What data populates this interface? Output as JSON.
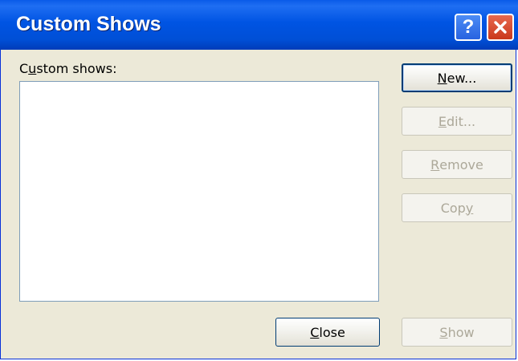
{
  "titlebar": {
    "title": "Custom Shows",
    "help_label": "?"
  },
  "list": {
    "label": {
      "pre": "C",
      "key": "u",
      "post": "stom shows:"
    },
    "items": []
  },
  "buttons": {
    "new": {
      "pre": "",
      "key": "N",
      "post": "ew..."
    },
    "edit": {
      "pre": "",
      "key": "E",
      "post": "dit..."
    },
    "remove": {
      "pre": "",
      "key": "R",
      "post": "emove"
    },
    "copy": {
      "pre": "Cop",
      "key": "y",
      "post": ""
    },
    "close": {
      "pre": "",
      "key": "C",
      "post": "lose"
    },
    "show": {
      "pre": "",
      "key": "S",
      "post": "how"
    }
  },
  "colors": {
    "titlebar": "#0054e3",
    "dialog_bg": "#ece9d8",
    "close_button": "#c9391c",
    "disabled_text": "#aca899"
  }
}
